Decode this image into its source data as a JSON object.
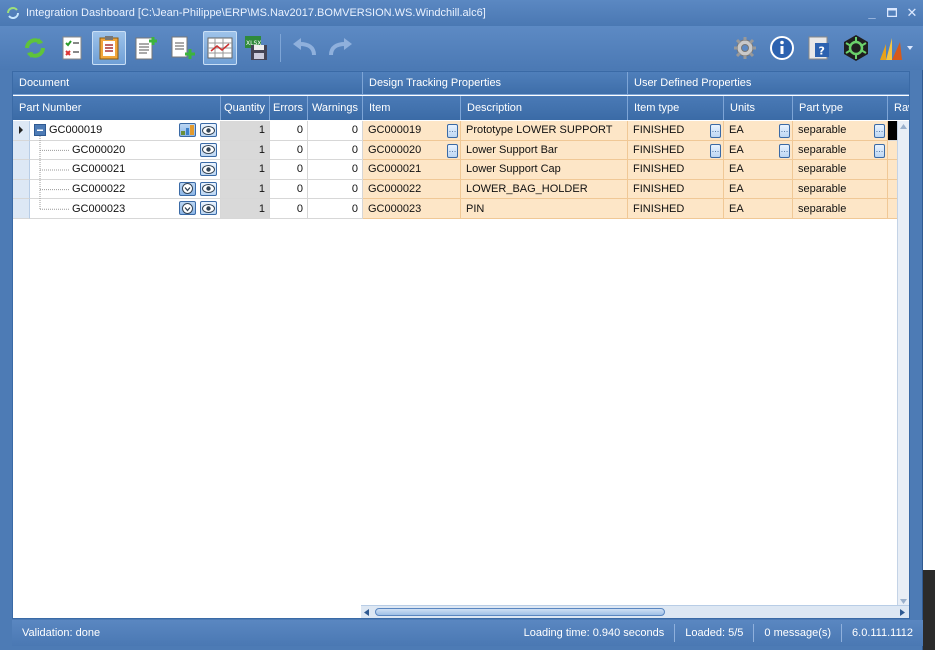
{
  "window": {
    "title": "Integration Dashboard [C:\\Jean-Philippe\\ERP\\MS.Nav2017.BOMVERSION.WS.Windchill.alc6]"
  },
  "toolbar": {
    "left_icons": [
      "refresh-icon",
      "checklist-icon",
      "clipboard-icon",
      "new-document-icon",
      "add-document-icon",
      "grid-view-icon",
      "save-xlsx-icon",
      "undo-icon",
      "redo-icon"
    ],
    "right_icons": [
      "gear-icon",
      "info-icon",
      "help-icon",
      "network-icon",
      "dynamics-icon"
    ]
  },
  "grid": {
    "bands": {
      "document": "Document",
      "design": "Design Tracking Properties",
      "user": "User Defined Properties"
    },
    "columns": {
      "part_number": "Part Number",
      "quantity": "Quantity",
      "errors": "Errors",
      "warnings": "Warnings",
      "item": "Item",
      "description": "Description",
      "item_type": "Item type",
      "units": "Units",
      "part_type": "Part type",
      "raw": "Raw"
    },
    "rows": [
      {
        "part": "GC000019",
        "quantity": "1",
        "errors": "0",
        "warnings": "0",
        "item": "GC000019",
        "description": "Prototype LOWER SUPPORT",
        "item_type": "FINISHED",
        "units": "EA",
        "part_type": "separable",
        "level": 0
      },
      {
        "part": "GC000020",
        "quantity": "1",
        "errors": "0",
        "warnings": "0",
        "item": "GC000020",
        "description": "Lower Support Bar",
        "item_type": "FINISHED",
        "units": "EA",
        "part_type": "separable",
        "level": 1
      },
      {
        "part": "GC000021",
        "quantity": "1",
        "errors": "0",
        "warnings": "0",
        "item": "GC000021",
        "description": "Lower Support Cap",
        "item_type": "FINISHED",
        "units": "EA",
        "part_type": "separable",
        "level": 1
      },
      {
        "part": "GC000022",
        "quantity": "1",
        "errors": "0",
        "warnings": "0",
        "item": "GC000022",
        "description": "LOWER_BAG_HOLDER",
        "item_type": "FINISHED",
        "units": "EA",
        "part_type": "separable",
        "level": 1
      },
      {
        "part": "GC000023",
        "quantity": "1",
        "errors": "0",
        "warnings": "0",
        "item": "GC000023",
        "description": "PIN",
        "item_type": "FINISHED",
        "units": "EA",
        "part_type": "separable",
        "level": 1
      }
    ]
  },
  "status": {
    "validation": "Validation: done",
    "loading_time": "Loading time: 0.940 seconds",
    "loaded": "Loaded: 5/5",
    "messages": "0 message(s)",
    "version": "6.0.111.1112"
  },
  "colors": {
    "frame": "#4d7bb5",
    "header": "#3e6ea9",
    "orange_cells": "#fde6c7",
    "quantity_cells": "#d9d9d9"
  }
}
